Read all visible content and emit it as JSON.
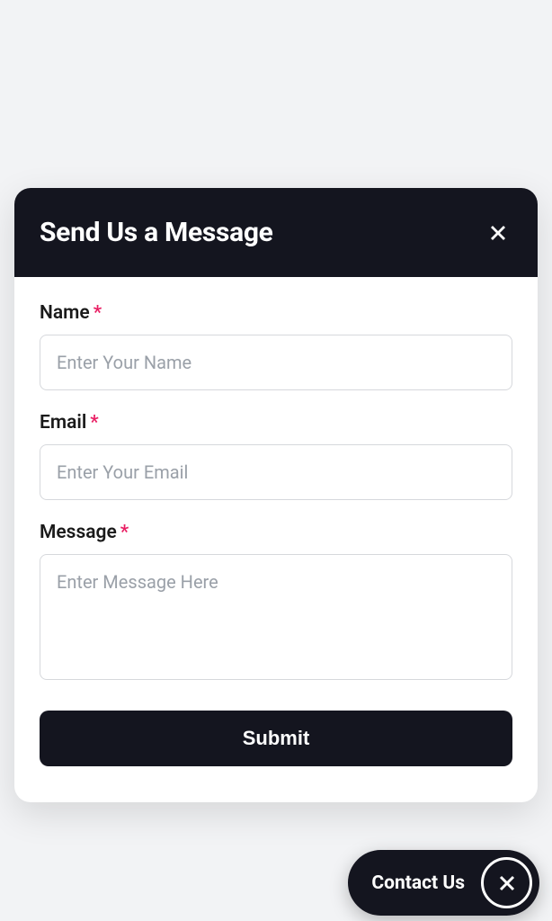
{
  "modal": {
    "title": "Send Us a Message",
    "fields": {
      "name": {
        "label": "Name",
        "placeholder": "Enter Your Name",
        "required": "*"
      },
      "email": {
        "label": "Email",
        "placeholder": "Enter Your Email",
        "required": "*"
      },
      "message": {
        "label": "Message",
        "placeholder": "Enter Message Here",
        "required": "*"
      }
    },
    "submit_label": "Submit"
  },
  "fab": {
    "label": "Contact Us"
  }
}
